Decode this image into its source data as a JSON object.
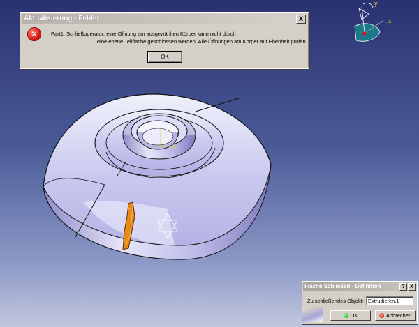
{
  "error_dialog": {
    "title": "Aktualisierung - Fehler",
    "close_glyph": "X",
    "message_line1": "Part1: Schließoperator: eine Öffnung am ausgewählten Körper kann nicht durch",
    "message_line2": "eine ebene Teilfläche geschlossen werden. Alle Öffnungen am Körper auf Ebenheit prüfen.",
    "ok_label": "OK",
    "icon": "error-icon"
  },
  "close_surface_dialog": {
    "title": "Fläche Schließen - Definition",
    "help_glyph": "?",
    "close_glyph": "X",
    "field_label": "Zu schließendes Objekt:",
    "field_value": "Extrudieren.1",
    "ok_label": "OK",
    "cancel_label": "Abbrechen"
  },
  "compass": {
    "y_label": "y",
    "x_label": "x"
  },
  "colors": {
    "background_top": "#2a3170",
    "background_bottom": "#c2c7de",
    "part_surface": "#c9c8ee",
    "highlight": "#e88a1a"
  }
}
